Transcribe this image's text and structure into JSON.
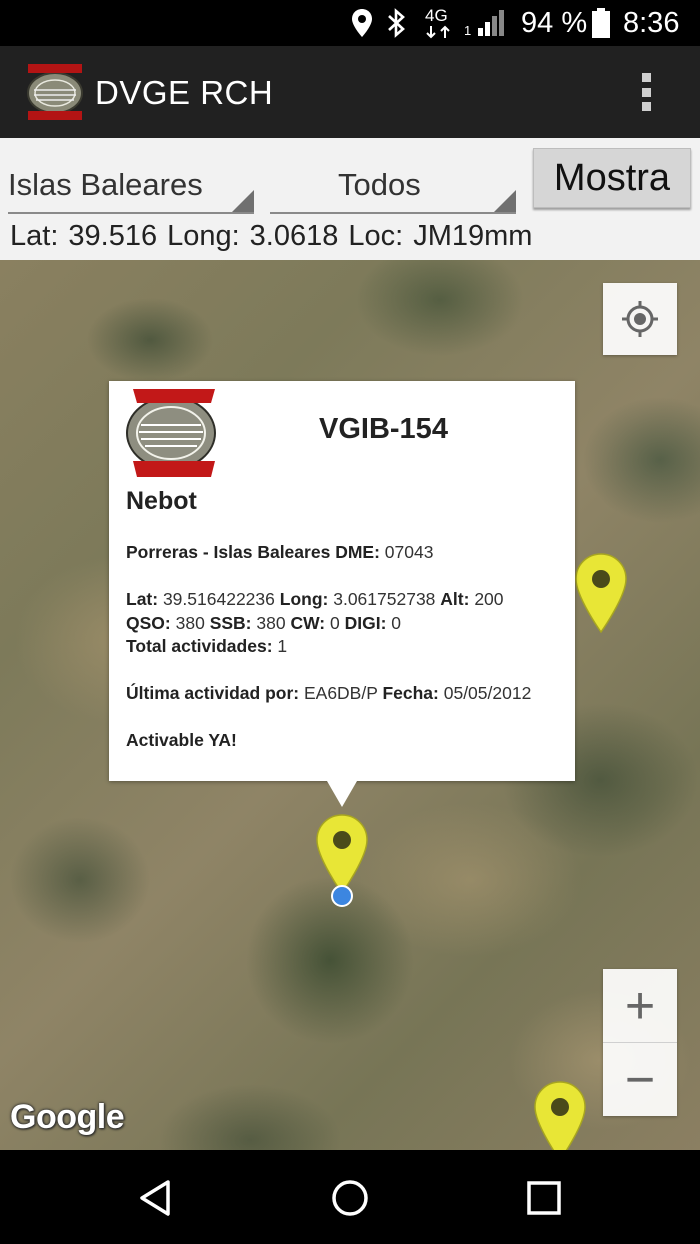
{
  "status_bar": {
    "network": "4G",
    "sim_slot": "1",
    "battery": "94 %",
    "time": "8:36",
    "icons": [
      "location-icon",
      "bluetooth-icon",
      "signal-icon",
      "battery-icon"
    ]
  },
  "app_bar": {
    "title": "DVGE RCH",
    "logo": "radio-club-henares-logo",
    "menu_icon": "overflow-menu-icon"
  },
  "filters": {
    "region": "Islas Baleares",
    "type": "Todos",
    "show_button": "Mostra"
  },
  "position": {
    "lat_label": "Lat:",
    "lat": "39.516",
    "long_label": "Long:",
    "long": "3.0618",
    "loc_label": "Loc:",
    "loc": "JM19mm"
  },
  "map": {
    "attribution": "Google",
    "zoom_in": "+",
    "zoom_out": "−",
    "marker_color": "#e8e636",
    "my_location_color": "#3c86e0"
  },
  "info_window": {
    "code": "VGIB-154",
    "name": "Nebot",
    "place": "Porreras - Islas Baleares",
    "dme_label": "DME:",
    "dme": "07043",
    "lat_label": "Lat:",
    "lat": "39.516422236",
    "long_label": "Long:",
    "long": "3.061752738",
    "alt_label": "Alt:",
    "alt": "200",
    "qso_label": "QSO:",
    "qso": "380",
    "ssb_label": "SSB:",
    "ssb": "380",
    "cw_label": "CW:",
    "cw": "0",
    "digi_label": "DIGI:",
    "digi": "0",
    "total_label": "Total actividades:",
    "total": "1",
    "last_label": "Última actividad por:",
    "last_by": "EA6DB/P",
    "date_label": "Fecha:",
    "date": "05/05/2012",
    "status": "Activable YA!"
  },
  "nav_bar": {
    "icons": [
      "back-icon",
      "home-icon",
      "recents-icon"
    ]
  }
}
